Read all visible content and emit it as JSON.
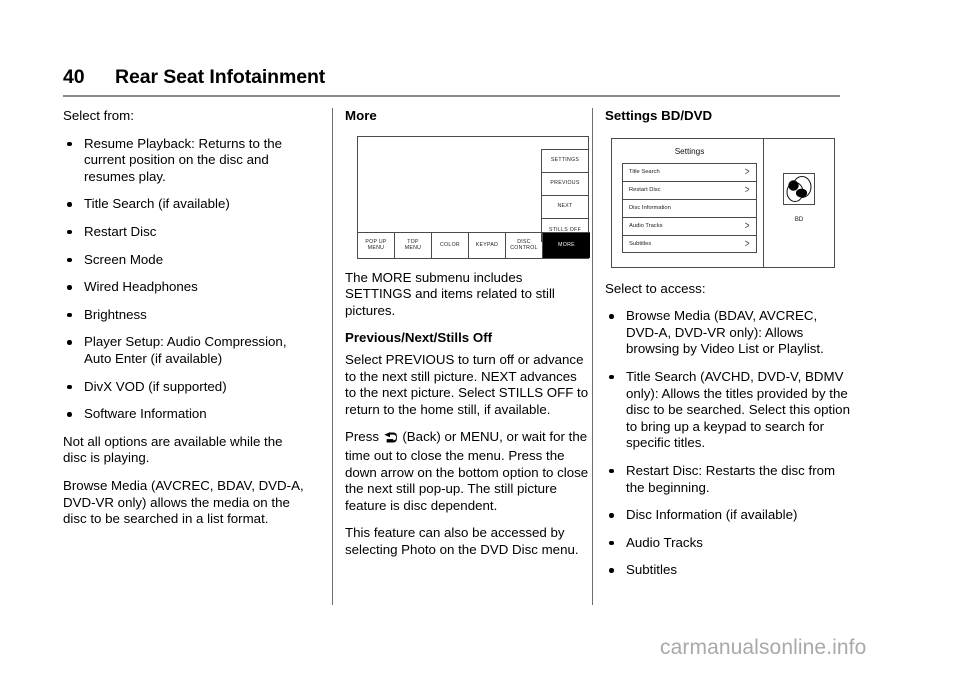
{
  "header": {
    "page_number": "40",
    "title": "Rear Seat Infotainment"
  },
  "column1": {
    "intro": "Select from:",
    "bullets": [
      "Resume Playback: Returns to the current position on the disc and resumes play.",
      "Title Search (if available)",
      "Restart Disc",
      "Screen Mode",
      "Wired Headphones",
      "Brightness",
      "Player Setup: Audio Compression, Auto Enter (if available)",
      "DivX VOD (if supported)",
      "Software Information"
    ],
    "para1": "Not all options are available while the disc is playing.",
    "para2": "Browse Media (AVCREC, BDAV, DVD-A, DVD-VR only) allows the media on the disc to be searched in a list format."
  },
  "column2": {
    "heading": "More",
    "figure": {
      "name": "more-menu-screen",
      "side_buttons": [
        "SETTINGS",
        "PREVIOUS",
        "NEXT",
        "STILLS OFF"
      ],
      "bottom_buttons": [
        {
          "line1": "POP UP",
          "line2": "MENU"
        },
        {
          "line1": "TOP",
          "line2": "MENU"
        },
        {
          "line1": "COLOR",
          "line2": ""
        },
        {
          "line1": "KEYPAD",
          "line2": ""
        },
        {
          "line1": "DISC",
          "line2": "CONTROL"
        },
        {
          "line1": "MORE",
          "line2": ""
        }
      ],
      "highlighted_button": "MORE"
    },
    "para1": "The MORE submenu includes SETTINGS and items related to still pictures.",
    "subhead": "Previous/Next/Stills Off",
    "para2_a": "Select PREVIOUS to turn off or advance to the next still picture. NEXT advances to the next picture. Select STILLS OFF to return to the home still, if available.",
    "para3_before": "Press ",
    "para3_after": " (Back) or MENU, or wait for the time out to close the menu. Press the down arrow on the bottom option to close the next still pop-up. The still picture feature is disc dependent.",
    "para4": "This feature can also be accessed by selecting Photo on the DVD Disc menu."
  },
  "column3": {
    "heading": "Settings BD/DVD",
    "figure": {
      "name": "settings-bd-dvd-screen",
      "panel_title": "Settings",
      "items": [
        {
          "label": "Title Search",
          "chevron": true
        },
        {
          "label": "Restart Disc",
          "chevron": true
        },
        {
          "label": "Disc Information",
          "chevron": false
        },
        {
          "label": "Audio Tracks",
          "chevron": true
        },
        {
          "label": "Subtitles",
          "chevron": true
        }
      ],
      "disc_label": "BD"
    },
    "intro": "Select to access:",
    "bullets": [
      "Browse Media (BDAV, AVCREC, DVD-A, DVD-VR only): Allows browsing by Video List or Playlist.",
      "Title Search (AVCHD, DVD-V, BDMV only): Allows the titles provided by the disc to be searched. Select this option to bring up a keypad to search for specific titles.",
      "Restart Disc: Restarts the disc from the beginning.",
      "Disc Information (if available)",
      "Audio Tracks",
      "Subtitles"
    ]
  },
  "watermark": {
    "text": "carmanualsonline.info"
  },
  "colors": {
    "text": "#000000",
    "rule": "#8a8a8a",
    "divider": "#6f6f6f",
    "figure_border": "#4a4a4a",
    "highlight_bg": "#000000",
    "highlight_fg": "#ffffff",
    "watermark": "#a9a9a9"
  }
}
